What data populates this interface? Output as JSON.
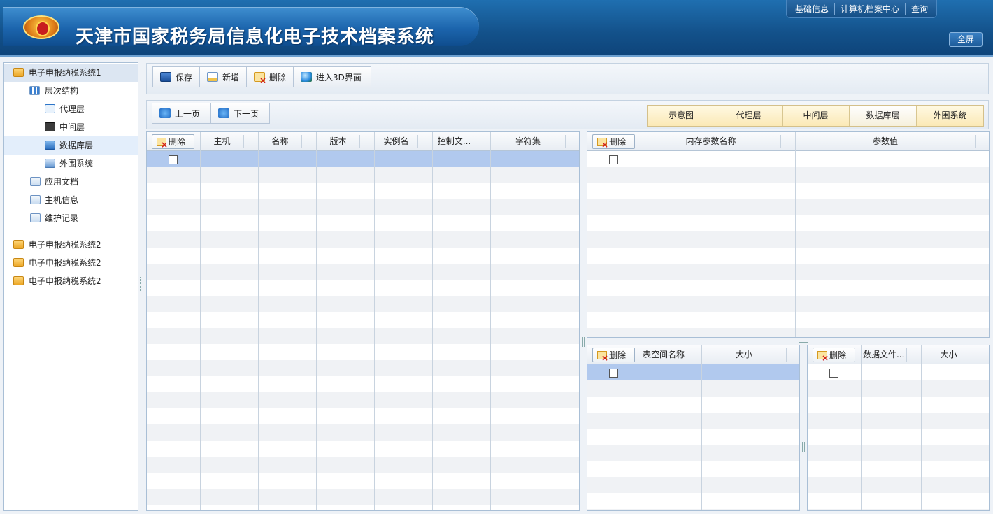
{
  "header": {
    "title": "天津市国家税务局信息化电子技术档案系统",
    "nav": [
      "基础信息",
      "计算机档案中心",
      "查询"
    ],
    "fullscreen_label": "全屏"
  },
  "tree": [
    {
      "label": "电子申报纳税系统1",
      "icon": "folder-icon"
    },
    {
      "label": "层次结构",
      "icon": "grid-icon"
    },
    {
      "label": "代理层",
      "icon": "proxy-layer-icon"
    },
    {
      "label": "中间层",
      "icon": "middle-layer-icon"
    },
    {
      "label": "数据库层",
      "icon": "database-icon"
    },
    {
      "label": "外围系统",
      "icon": "external-system-icon"
    },
    {
      "label": "应用文档",
      "icon": "document-icon"
    },
    {
      "label": "主机信息",
      "icon": "document-icon"
    },
    {
      "label": "维护记录",
      "icon": "document-icon"
    },
    {
      "label": "电子申报纳税系统2",
      "icon": "folder-icon"
    },
    {
      "label": "电子申报纳税系统2",
      "icon": "folder-icon"
    },
    {
      "label": "电子申报纳税系统2",
      "icon": "folder-icon"
    }
  ],
  "toolbar": {
    "save_label": "保存",
    "add_label": "新增",
    "delete_label": "删除",
    "enter3d_label": "进入3D界面"
  },
  "pager": {
    "prev_label": "上一页",
    "next_label": "下一页"
  },
  "tabs": [
    "示意图",
    "代理层",
    "中间层",
    "数据库层",
    "外围系统"
  ],
  "active_tab": "数据库层",
  "main_grid": {
    "delete_label": "删除",
    "columns": [
      "主机",
      "名称",
      "版本",
      "实例名",
      "控制文...",
      "字符集"
    ]
  },
  "memory_grid": {
    "delete_label": "删除",
    "columns": [
      "内存参数名称",
      "参数值"
    ]
  },
  "tablespace_grid": {
    "delete_label": "删除",
    "columns": [
      "表空间名称",
      "大小"
    ]
  },
  "datafile_grid": {
    "delete_label": "删除",
    "columns": [
      "数据文件...",
      "大小"
    ]
  }
}
